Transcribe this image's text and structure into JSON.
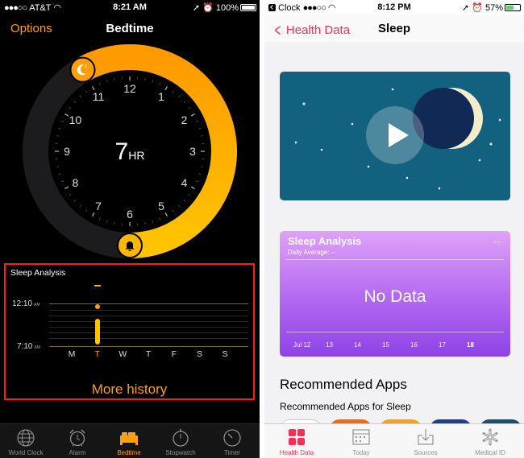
{
  "left": {
    "status": {
      "carrier": "AT&T",
      "time": "8:21 AM",
      "battery": "100%",
      "battery_level": 1.0
    },
    "nav": {
      "options_label": "Options",
      "title": "Bedtime"
    },
    "clock": {
      "numbers": [
        "12",
        "1",
        "2",
        "3",
        "4",
        "5",
        "6",
        "7",
        "8",
        "9",
        "10",
        "11"
      ],
      "hours_value": "7",
      "hours_unit": "HR",
      "sleep_start_hour": 11,
      "sleep_end_hour": 6
    },
    "analysis": {
      "title": "Sleep Analysis",
      "y_top_time": "12:10",
      "y_top_ampm": "AM",
      "y_bottom_time": "7:10",
      "y_bottom_ampm": "AM",
      "days": [
        "M",
        "T",
        "W",
        "T",
        "F",
        "S",
        "S"
      ],
      "today_index": 1,
      "more_history": "More history"
    },
    "tabs": [
      {
        "label": "World Clock",
        "icon": "globe-icon"
      },
      {
        "label": "Alarm",
        "icon": "alarm-clock-icon"
      },
      {
        "label": "Bedtime",
        "icon": "bed-icon"
      },
      {
        "label": "Stopwatch",
        "icon": "stopwatch-icon"
      },
      {
        "label": "Timer",
        "icon": "timer-icon"
      }
    ],
    "active_tab": 2,
    "accent": "#ff9f0a"
  },
  "right": {
    "status": {
      "back_app": "Clock",
      "time": "8:12 PM",
      "battery": "57%",
      "battery_level": 0.57
    },
    "nav": {
      "back_label": "Health Data",
      "title": "Sleep"
    },
    "card": {
      "title": "Sleep Analysis",
      "subtitle": "Daily Average: --",
      "value": "--",
      "no_data": "No Data",
      "dates": [
        "Jul 12",
        "13",
        "14",
        "15",
        "16",
        "17",
        "18"
      ],
      "current_index": 6
    },
    "recommended": {
      "heading": "Recommended Apps",
      "subheading": "Recommended Apps for Sleep"
    },
    "tabs": [
      {
        "label": "Health Data",
        "icon": "health-data-grid-icon"
      },
      {
        "label": "Today",
        "icon": "calendar-icon"
      },
      {
        "label": "Sources",
        "icon": "sources-download-icon"
      },
      {
        "label": "Medical ID",
        "icon": "medical-id-icon"
      }
    ],
    "active_tab": 0,
    "accent": "#ff2d55"
  }
}
